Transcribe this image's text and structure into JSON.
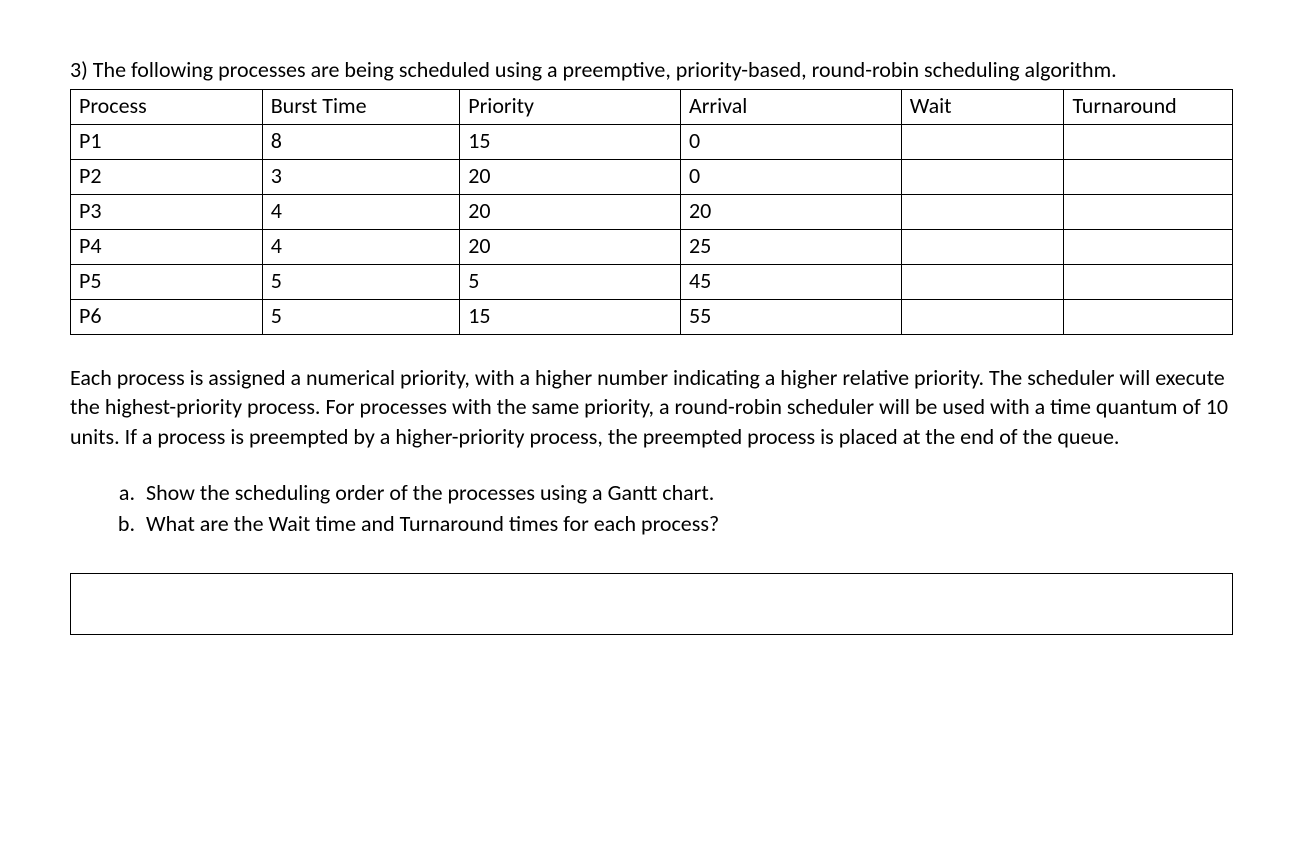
{
  "intro": "3) The following processes are being scheduled using a preemptive, priority-based, round-robin scheduling algorithm.",
  "table": {
    "headers": [
      "Process",
      "Burst Time",
      "Priority",
      "Arrival",
      "Wait",
      "Turnaround"
    ],
    "rows": [
      {
        "process": "P1",
        "burst": "8",
        "priority": "15",
        "arrival": "0",
        "wait": "",
        "turnaround": ""
      },
      {
        "process": "P2",
        "burst": "3",
        "priority": "20",
        "arrival": "0",
        "wait": "",
        "turnaround": ""
      },
      {
        "process": "P3",
        "burst": "4",
        "priority": "20",
        "arrival": "20",
        "wait": "",
        "turnaround": ""
      },
      {
        "process": "P4",
        "burst": "4",
        "priority": "20",
        "arrival": "25",
        "wait": "",
        "turnaround": ""
      },
      {
        "process": "P5",
        "burst": "5",
        "priority": "5",
        "arrival": "45",
        "wait": "",
        "turnaround": ""
      },
      {
        "process": "P6",
        "burst": "5",
        "priority": "15",
        "arrival": "55",
        "wait": "",
        "turnaround": ""
      }
    ]
  },
  "description": "Each process is assigned a numerical priority, with a higher number indicating a higher relative priority. The scheduler will execute the highest-priority process. For processes with the same priority, a round-robin scheduler will be used with a time quantum of 10 units. If a process is preempted by a higher-priority process, the preempted process is placed at the end of the queue.",
  "questions": {
    "a": "Show the scheduling order of the processes using a Gantt chart.",
    "b": "What are the Wait time and Turnaround times for each process?"
  }
}
